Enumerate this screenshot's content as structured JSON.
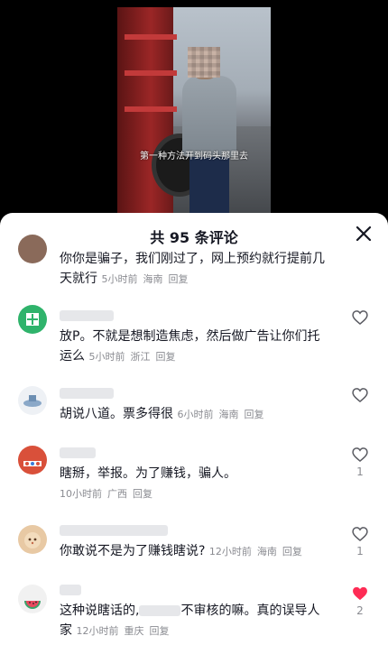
{
  "video": {
    "subtitle": "第一种方法开到码头那里去"
  },
  "sheet": {
    "title": "共 95 条评论"
  },
  "comments": [
    {
      "line1": "你你是骗子，我们刚过了，网上预约就行提前几",
      "line2": "天就行",
      "time": "5小时前",
      "region": "海南",
      "reply": "回复"
    },
    {
      "line1": "放P。不就是想制造焦虑，然后做广告让你们托",
      "line2": "运么",
      "time": "5小时前",
      "region": "浙江",
      "reply": "回复",
      "likes": ""
    },
    {
      "line1": "胡说八道。票多得很",
      "time": "6小时前",
      "region": "海南",
      "reply": "回复",
      "likes": ""
    },
    {
      "line1": "瞎掰，举报。为了赚钱，骗人。",
      "time": "10小时前",
      "region": "广西",
      "reply": "回复",
      "likes": "1"
    },
    {
      "line1": "你敢说不是为了赚钱瞎说?",
      "time": "12小时前",
      "region": "海南",
      "reply": "回复",
      "likes": "1"
    },
    {
      "line1a": "这种说瞎话的,",
      "line1b": "不审核的嘛。真的误导人",
      "line2": "家",
      "time": "12小时前",
      "region": "重庆",
      "reply": "回复",
      "likes": "2"
    }
  ],
  "colors": {
    "liked": "#fe2c55",
    "meta": "#8a8b91",
    "text": "#161823"
  }
}
